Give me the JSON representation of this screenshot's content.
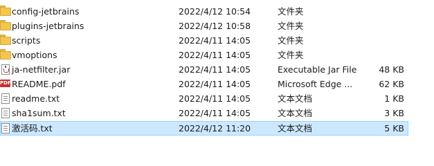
{
  "files": [
    {
      "name": "config-jetbrains",
      "date": "2022/4/12 10:54",
      "type": "文件夹",
      "size": "",
      "icon": "folder-icon"
    },
    {
      "name": "plugins-jetbrains",
      "date": "2022/4/12 10:58",
      "type": "文件夹",
      "size": "",
      "icon": "folder-icon"
    },
    {
      "name": "scripts",
      "date": "2022/4/11 14:05",
      "type": "文件夹",
      "size": "",
      "icon": "folder-icon"
    },
    {
      "name": "vmoptions",
      "date": "2022/4/11 14:05",
      "type": "文件夹",
      "size": "",
      "icon": "folder-icon"
    },
    {
      "name": "ja-netfilter.jar",
      "date": "2022/4/11 14:05",
      "type": "Executable Jar File",
      "size": "48 KB",
      "icon": "jar-file-icon"
    },
    {
      "name": "README.pdf",
      "date": "2022/4/11 14:05",
      "type": "Microsoft Edge ...",
      "size": "62 KB",
      "icon": "pdf-file-icon",
      "icon_text": "PDF"
    },
    {
      "name": "readme.txt",
      "date": "2022/4/11 14:05",
      "type": "文本文档",
      "size": "1 KB",
      "icon": "text-file-icon"
    },
    {
      "name": "sha1sum.txt",
      "date": "2022/4/11 14:05",
      "type": "文本文档",
      "size": "3 KB",
      "icon": "text-file-icon"
    },
    {
      "name": "激活码.txt",
      "date": "2022/4/12 11:20",
      "type": "文本文档",
      "size": "5 KB",
      "icon": "text-file-icon",
      "selected": true
    }
  ],
  "colors": {
    "selection_bg": "#cce8ff",
    "selection_border": "#99d1ff",
    "folder": "#f3c64f",
    "pdf": "#c9302c"
  }
}
